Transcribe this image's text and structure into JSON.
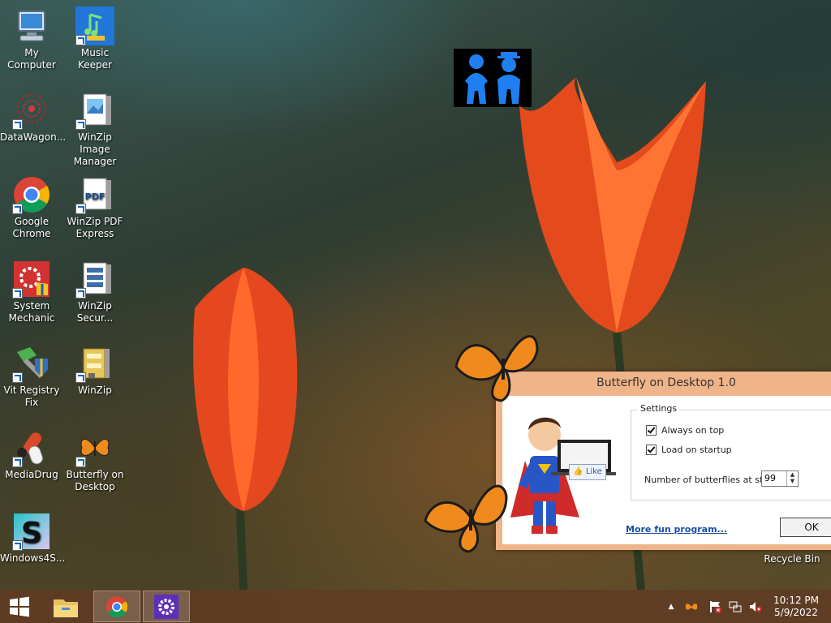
{
  "desktop": {
    "icons": [
      {
        "label": "My Computer",
        "icon": "computer-icon"
      },
      {
        "label": "Music Keeper",
        "icon": "music-icon"
      },
      {
        "label": "DataWagon...",
        "icon": "datawagon-icon"
      },
      {
        "label": "WinZip Image Manager",
        "icon": "image-manager-icon"
      },
      {
        "label": "Google Chrome",
        "icon": "chrome-icon"
      },
      {
        "label": "WinZip PDF Express",
        "icon": "pdf-icon"
      },
      {
        "label": "System Mechanic",
        "icon": "system-mechanic-icon"
      },
      {
        "label": "WinZip Secur...",
        "icon": "winzip-secure-icon"
      },
      {
        "label": "Vit Registry Fix",
        "icon": "registry-fix-icon"
      },
      {
        "label": "WinZip",
        "icon": "winzip-icon"
      },
      {
        "label": "MediaDrug",
        "icon": "mediadrug-icon"
      },
      {
        "label": "Butterfly on Desktop",
        "icon": "butterfly-icon"
      },
      {
        "label": "Windows4S...",
        "icon": "windows4s-icon"
      },
      {
        "label": "Recycle Bin",
        "icon": "recycle-bin-icon"
      }
    ]
  },
  "dialog": {
    "title": "Butterfly on Desktop 1.0",
    "like_label": "Like",
    "settings_title": "Settings",
    "always_on_top": "Always on top",
    "load_on_startup": "Load on startup",
    "butterflies_label": "Number of butterflies at start",
    "butterflies_value": "99",
    "more_link": "More fun program...",
    "ok_label": "OK"
  },
  "taskbar": {
    "time": "10:12 PM",
    "date": "5/9/2022",
    "tray_up": "▲"
  },
  "colors": {
    "taskbar": "#5f3c23",
    "dialog_frame": "#f0b48a",
    "link": "#1a4fa0"
  }
}
